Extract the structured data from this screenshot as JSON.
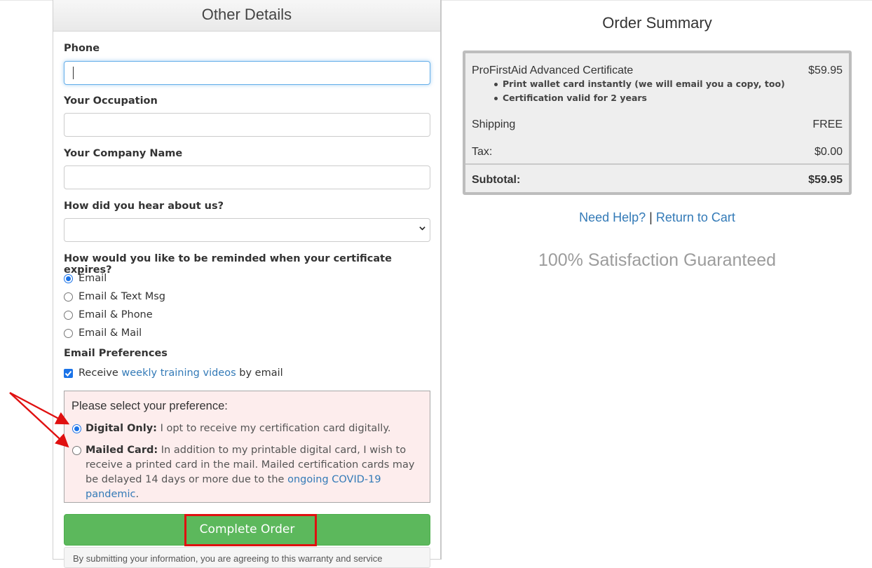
{
  "form": {
    "header": "Other Details",
    "phone": {
      "label": "Phone",
      "value": ""
    },
    "occupation": {
      "label": "Your Occupation",
      "value": ""
    },
    "company": {
      "label": "Your Company Name",
      "value": ""
    },
    "hear_about": {
      "label": "How did you hear about us?",
      "selected": ""
    },
    "reminder": {
      "label": "How would you like to be reminded when your certificate expires?",
      "options": [
        "Email",
        "Email & Text Msg",
        "Email & Phone",
        "Email & Mail"
      ],
      "selected": "Email"
    },
    "email_prefs": {
      "label": "Email Preferences",
      "checked": true,
      "text_before": "Receive",
      "link_text": "weekly training videos",
      "text_after": "by email"
    },
    "preference": {
      "title": "Please select your preference:",
      "digital": {
        "label": "Digital Only:",
        "text": "I opt to receive my certification card digitally.",
        "checked": true
      },
      "mailed": {
        "label": "Mailed Card:",
        "text": "In addition to my printable digital card, I wish to receive a printed card in the mail. Mailed certification cards may be delayed 14 days or more due to the",
        "link_text": "ongoing COVID-19 pandemic",
        "trailing": ".",
        "checked": false
      }
    },
    "submit_label": "Complete Order",
    "notice": "By submitting your information, you are agreeing to this warranty and service"
  },
  "summary": {
    "title": "Order Summary",
    "product": {
      "name": "ProFirstAid Advanced Certificate",
      "price": "$59.95",
      "bullets": [
        "Print wallet card instantly (we will email you a copy, too)",
        "Certification valid for 2 years"
      ]
    },
    "shipping": {
      "label": "Shipping",
      "value": "FREE"
    },
    "tax": {
      "label": "Tax:",
      "value": "$0.00"
    },
    "subtotal": {
      "label": "Subtotal:",
      "value": "$59.95"
    }
  },
  "help": {
    "need_help": "Need Help?",
    "divider": "|",
    "return_cart": "Return to Cart"
  },
  "guarantee": "100% Satisfaction Guaranteed",
  "colors": {
    "accent": "#337ab7",
    "success": "#5cb85c",
    "annotation": "#e01010",
    "pref_bg": "#fdeded"
  }
}
